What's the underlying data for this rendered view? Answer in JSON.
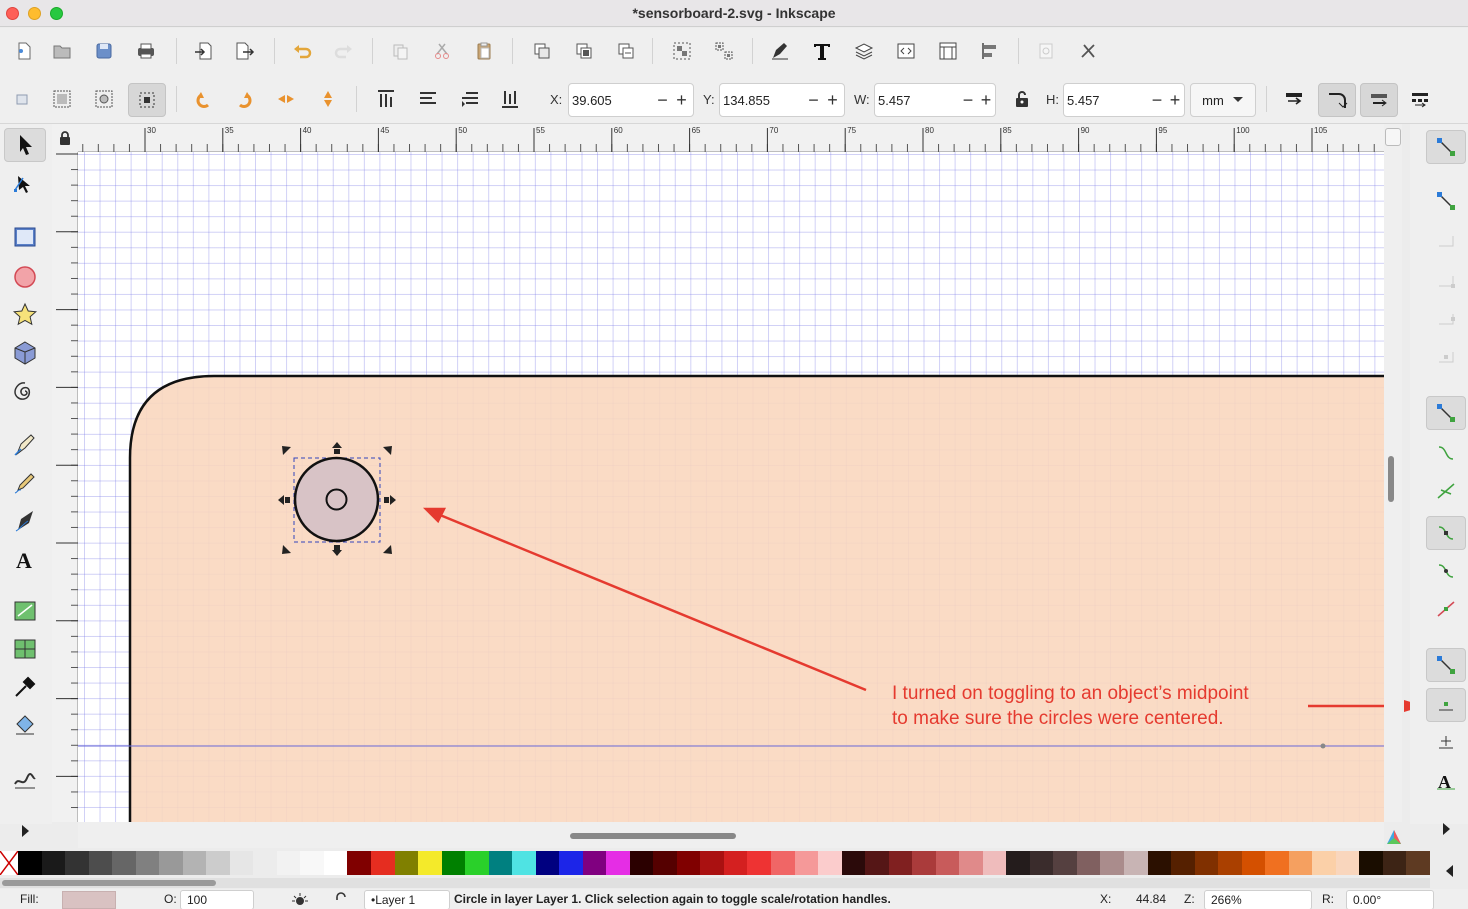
{
  "window": {
    "title": "*sensorboard-2.svg - Inkscape"
  },
  "controls": {
    "x": {
      "label": "X:",
      "value": "39.605"
    },
    "y": {
      "label": "Y:",
      "value": "134.855"
    },
    "w": {
      "label": "W:",
      "value": "5.457"
    },
    "h": {
      "label": "H:",
      "value": "5.457"
    },
    "unit": "mm"
  },
  "ruler": {
    "h_ticks": [
      "30",
      "35",
      "40",
      "45",
      "50",
      "55",
      "60",
      "65",
      "70",
      "75",
      "80",
      "85",
      "90",
      "95",
      "100",
      "105"
    ]
  },
  "annotation": {
    "line1": "I turned on toggling to an object’s midpoint",
    "line2": "to make sure the circles were centered."
  },
  "colors": {
    "board_fill": "#f9d6bd",
    "annotation": "#e53a2f",
    "selection_circle_fill": "#d8c3c6",
    "swatches": [
      "#000000",
      "#1a1a1a",
      "#333333",
      "#4d4d4d",
      "#666666",
      "#808080",
      "#999999",
      "#b3b3b3",
      "#cccccc",
      "#e6e6e6",
      "#ececec",
      "#f2f2f2",
      "#f8f8f8",
      "#ffffff",
      "#800000",
      "#e52d20",
      "#808000",
      "#f4ea2a",
      "#008000",
      "#2ad02a",
      "#008080",
      "#4fe3e3",
      "#000080",
      "#1c25e8",
      "#800080",
      "#e52de5",
      "#2b0000",
      "#550000",
      "#800000",
      "#aa1111",
      "#d42020",
      "#ee3333",
      "#f06666",
      "#f59999",
      "#fbcccc",
      "#2b0a0a",
      "#551616",
      "#802020",
      "#aa3b3b",
      "#c85b5b",
      "#e08a8a",
      "#efbcbc",
      "#241c1c",
      "#3a2c2c",
      "#554040",
      "#806060",
      "#aa8c8c",
      "#c8b4b4",
      "#2b1000",
      "#552000",
      "#803000",
      "#aa4000",
      "#d45000",
      "#f07020",
      "#f5a060",
      "#fbd0a8",
      "#f9d6bd",
      "#1a0d00",
      "#3d2415",
      "#5e3a22"
    ]
  },
  "status": {
    "fill_label": "Fill:",
    "opacity_label": "O:",
    "opacity_value": "100",
    "layer": "•Layer 1",
    "message": "Circle  in layer Layer 1. Click selection again to toggle scale/rotation handles.",
    "x_label": "X:",
    "x_value": "44.84",
    "zoom_label": "Z:",
    "zoom_value": "266%",
    "rot_label": "R:",
    "rot_value": "0.00°"
  }
}
